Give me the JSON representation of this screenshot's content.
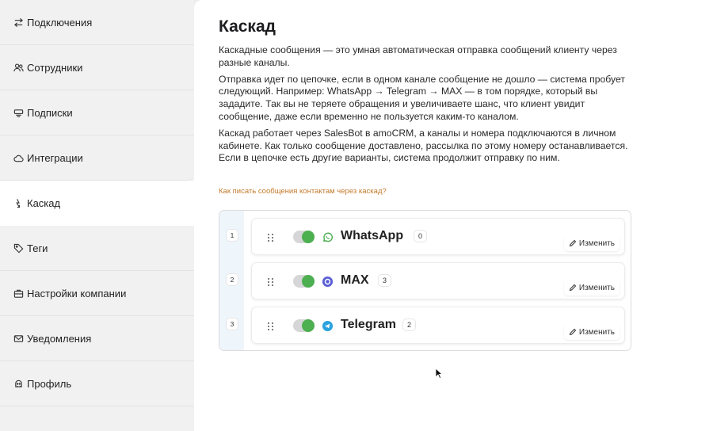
{
  "sidebar": {
    "items": [
      {
        "label": "Подключения",
        "icon": "arrows-swap-icon"
      },
      {
        "label": "Сотрудники",
        "icon": "users-icon"
      },
      {
        "label": "Подписки",
        "icon": "cash-icon"
      },
      {
        "label": "Интеграции",
        "icon": "cloud-icon"
      },
      {
        "label": "Каскад",
        "icon": "cascade-icon",
        "active": true
      },
      {
        "label": "Теги",
        "icon": "tag-icon"
      },
      {
        "label": "Настройки компании",
        "icon": "briefcase-icon"
      },
      {
        "label": "Уведомления",
        "icon": "mail-icon"
      },
      {
        "label": "Профиль",
        "icon": "profile-icon"
      }
    ]
  },
  "main": {
    "title": "Каскад",
    "paragraphs": [
      "Каскадные сообщения — это умная автоматическая отправка сообщений клиенту через разные каналы.",
      "Отправка идет по цепочке, если в одном канале сообщение не дошло — система пробует следующий. Например: WhatsApp → Telegram → MAX — в том порядке, который вы зададите. Так вы не теряете обращения и увеличиваете шанс, что клиент увидит сообщение, даже если временно не пользуется каким-то каналом.",
      "Каскад работает через SalesBot в amoCRM, а каналы и номера подключаются в личном кабинете. Как только сообщение доставлено, рассылка по этому номеру останавливается. Если в цепочке есть другие варианты, система продолжит отправку по ним."
    ],
    "help_link": "Как писать сообщения контактам через каскад?"
  },
  "cascade": {
    "edit_label": "Изменить",
    "channels": [
      {
        "order": "1",
        "name": "WhatsApp",
        "count": "0",
        "enabled": true,
        "icon": "whatsapp-icon",
        "color": "#4caf50"
      },
      {
        "order": "2",
        "name": "MAX",
        "count": "3",
        "enabled": true,
        "icon": "max-icon",
        "color": "#5b5fd6"
      },
      {
        "order": "3",
        "name": "Telegram",
        "count": "2",
        "enabled": true,
        "icon": "telegram-icon",
        "color": "#2aa3df"
      }
    ]
  },
  "colors": {
    "accent_toggle": "#4caf50",
    "link": "#c47a2c",
    "gutter": "#eef5fb"
  }
}
